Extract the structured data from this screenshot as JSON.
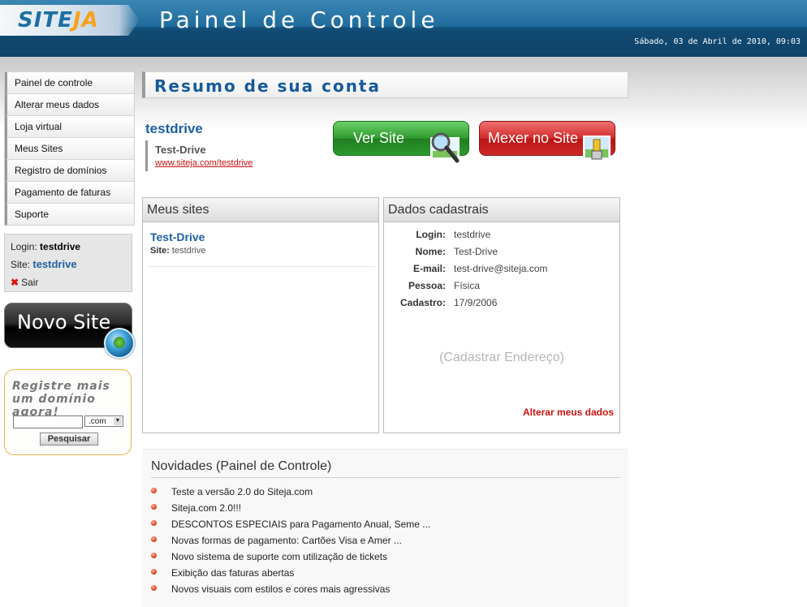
{
  "header": {
    "logo_part1": "SITE",
    "logo_part2": "JA",
    "title": "Painel de Controle",
    "date": "Sábado, 03 de Abril de 2010, 09:03"
  },
  "sidebar": {
    "items": [
      {
        "label": "Painel de controle"
      },
      {
        "label": "Alterar meus dados"
      },
      {
        "label": "Loja virtual"
      },
      {
        "label": "Meus Sites"
      },
      {
        "label": "Registro de domínios"
      },
      {
        "label": "Pagamento de faturas"
      },
      {
        "label": "Suporte"
      }
    ],
    "login_label": "Login:",
    "login_value": "testdrive",
    "site_label": "Site:",
    "site_value": "testdrive",
    "logout_label": "Sair",
    "novo_site_label": "Novo Site",
    "register": {
      "title": "Registre mais um domínio agora!",
      "tld": ".com",
      "search_label": "Pesquisar"
    }
  },
  "main": {
    "page_title": "Resumo de sua conta",
    "account_name": "testdrive",
    "account_title": "Test-Drive",
    "account_url": "www.siteja.com/testdrive",
    "btn_view": "Ver Site",
    "btn_edit": "Mexer no Site",
    "meus_sites": {
      "title": "Meus sites",
      "site_name": "Test-Drive",
      "site_label": "Site:",
      "site_value": "testdrive"
    },
    "dados": {
      "title": "Dados cadastrais",
      "rows": [
        {
          "k": "Login:",
          "v": "testdrive"
        },
        {
          "k": "Nome:",
          "v": "Test-Drive"
        },
        {
          "k": "E-mail:",
          "v": "test-drive@siteja.com"
        },
        {
          "k": "Pessoa:",
          "v": "Física"
        },
        {
          "k": "Cadastro:",
          "v": "17/9/2006"
        }
      ],
      "cadastrar": "(Cadastrar Endereço)",
      "alterar": "Alterar meus dados"
    },
    "news": {
      "title": "Novidades (Painel de Controle)",
      "items": [
        "Teste a versão 2.0 do Siteja.com",
        "Siteja.com 2.0!!!",
        "DESCONTOS ESPECIAIS para Pagamento Anual, Seme ...",
        "Novas formas de pagamento: Cartões Visa e Amer ...",
        "Novo sistema de suporte com utilização de tickets",
        "Exibição das faturas abertas",
        "Novos visuais com estilos e cores mais agressivas"
      ]
    }
  }
}
